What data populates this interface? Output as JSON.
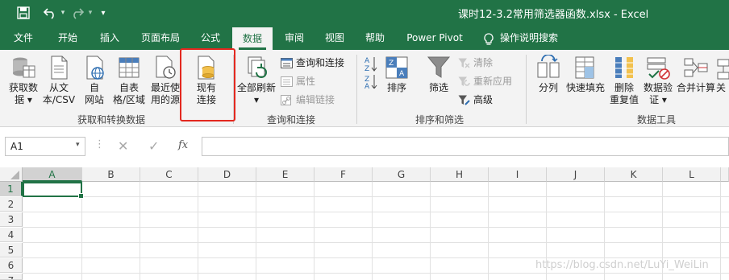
{
  "window": {
    "title": "课时12-3.2常用筛选器函数.xlsx  -  Excel",
    "quick_access": [
      "save-icon",
      "undo-icon",
      "redo-icon",
      "customize-icon"
    ]
  },
  "tabs": [
    {
      "label": "文件",
      "active": false
    },
    {
      "label": "开始",
      "active": false
    },
    {
      "label": "插入",
      "active": false
    },
    {
      "label": "页面布局",
      "active": false
    },
    {
      "label": "公式",
      "active": false
    },
    {
      "label": "数据",
      "active": true
    },
    {
      "label": "审阅",
      "active": false
    },
    {
      "label": "视图",
      "active": false
    },
    {
      "label": "帮助",
      "active": false
    },
    {
      "label": "Power Pivot",
      "active": false
    },
    {
      "label": "操作说明搜索",
      "active": false
    }
  ],
  "ribbon": {
    "get_transform": {
      "label": "获取和转换数据",
      "buttons": [
        {
          "line1": "获取数",
          "line2": "据 ▾",
          "icon": "database-icon"
        },
        {
          "line1": "从文",
          "line2": "本/CSV",
          "icon": "text-file-icon"
        },
        {
          "line1": "自",
          "line2": "网站",
          "icon": "web-icon"
        },
        {
          "line1": "自表",
          "line2": "格/区域",
          "icon": "table-icon"
        },
        {
          "line1": "最近使",
          "line2": "用的源",
          "icon": "recent-sources-icon"
        }
      ]
    },
    "existing_connections": {
      "line1": "现有",
      "line2": "连接",
      "icon": "existing-connections-icon"
    },
    "queries": {
      "label": "查询和连接",
      "refresh_all": {
        "line1": "全部刷新",
        "line2": "▾",
        "icon": "refresh-all-icon"
      },
      "small": [
        {
          "label": "查询和连接",
          "disabled": false,
          "icon": "queries-icon"
        },
        {
          "label": "属性",
          "disabled": true,
          "icon": "properties-icon"
        },
        {
          "label": "编辑链接",
          "disabled": true,
          "icon": "edit-links-icon"
        }
      ]
    },
    "sort_filter": {
      "label": "排序和筛选",
      "sort": {
        "label": "排序",
        "icon": "sort-icon"
      },
      "filter": {
        "label": "筛选",
        "icon": "filter-icon"
      },
      "small": [
        {
          "label": "清除",
          "disabled": true,
          "icon": "clear-filter-icon"
        },
        {
          "label": "重新应用",
          "disabled": true,
          "icon": "reapply-icon"
        },
        {
          "label": "高级",
          "disabled": false,
          "icon": "advanced-filter-icon"
        }
      ]
    },
    "data_tools": {
      "label": "数据工具",
      "buttons": [
        {
          "line1": "分列",
          "line2": "",
          "icon": "text-to-columns-icon"
        },
        {
          "line1": "快速填充",
          "line2": "",
          "icon": "flash-fill-icon"
        },
        {
          "line1": "删除",
          "line2": "重复值",
          "icon": "remove-duplicates-icon"
        },
        {
          "line1": "数据验",
          "line2": "证 ▾",
          "icon": "data-validation-icon"
        },
        {
          "line1": "合并计算",
          "line2": "",
          "icon": "consolidate-icon"
        },
        {
          "line1": "关",
          "line2": "",
          "icon": "relationships-icon"
        }
      ]
    }
  },
  "formula_bar": {
    "name_box": "A1",
    "fx": "fx",
    "value": ""
  },
  "sheet": {
    "columns": [
      "A",
      "B",
      "C",
      "D",
      "E",
      "F",
      "G",
      "H",
      "I",
      "J",
      "K",
      "L"
    ],
    "rows": [
      "1",
      "2",
      "3",
      "4",
      "5",
      "6",
      "7"
    ],
    "selected": "A1"
  },
  "watermark": "https://blog.csdn.net/LuYi_WeiLin",
  "colors": {
    "accent": "#217346",
    "highlight": "#e3281f"
  }
}
